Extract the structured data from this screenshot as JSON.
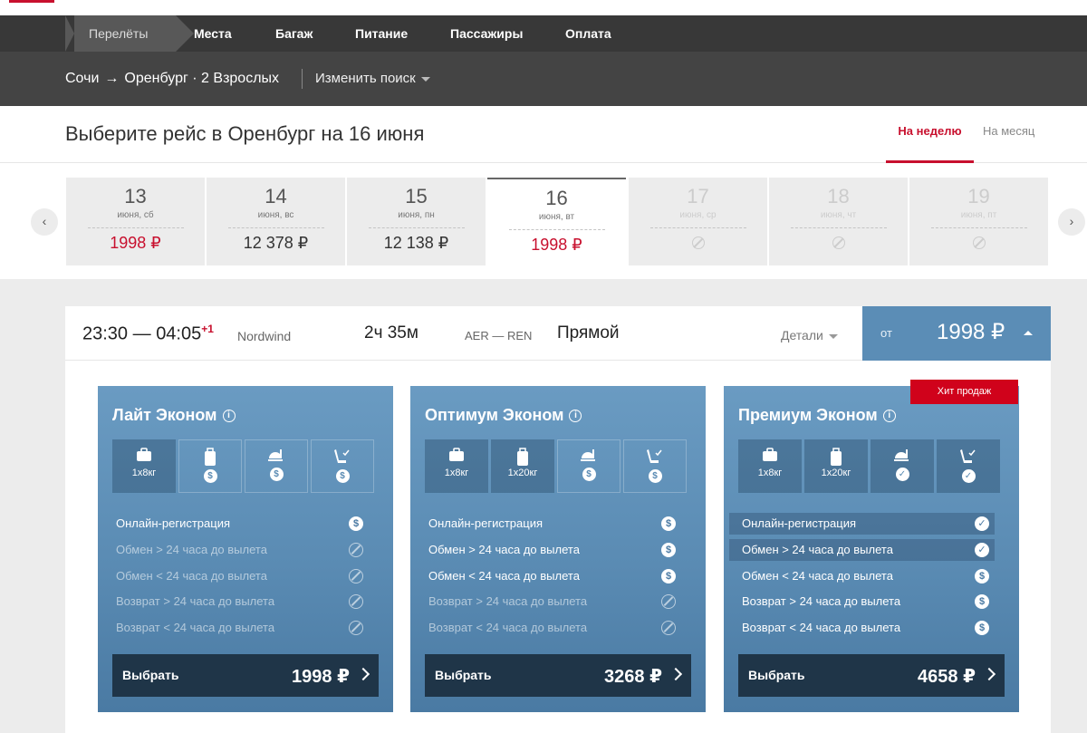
{
  "steps": [
    {
      "label": "Перелёты"
    },
    {
      "label": "Места"
    },
    {
      "label": "Багаж"
    },
    {
      "label": "Питание"
    },
    {
      "label": "Пассажиры"
    },
    {
      "label": "Оплата"
    }
  ],
  "route": {
    "from": "Сочи",
    "arrow": "→",
    "to": "Оренбург",
    "passengers": "· 2 Взрослых",
    "change_label": "Изменить поиск"
  },
  "title": "Выберите рейс в Оренбург на 16 июня",
  "view_tabs": {
    "week": "На неделю",
    "month": "На месяц"
  },
  "nav": {
    "prev": "‹",
    "next": "›"
  },
  "days": [
    {
      "num": "13",
      "weekday": "июня, сб",
      "price": "1998 ₽",
      "lowest": true,
      "available": true
    },
    {
      "num": "14",
      "weekday": "июня, вс",
      "price": "12 378 ₽",
      "lowest": false,
      "available": true
    },
    {
      "num": "15",
      "weekday": "июня, пн",
      "price": "12 138 ₽",
      "lowest": false,
      "available": true
    },
    {
      "num": "16",
      "weekday": "июня, вт",
      "price": "1998 ₽",
      "lowest": true,
      "available": true,
      "selected": true
    },
    {
      "num": "17",
      "weekday": "июня, ср",
      "price": "",
      "available": false
    },
    {
      "num": "18",
      "weekday": "июня, чт",
      "price": "",
      "available": false
    },
    {
      "num": "19",
      "weekday": "июня, пт",
      "price": "",
      "available": false
    }
  ],
  "flight": {
    "dep": "23:30",
    "dash": " — ",
    "arr": "04:05",
    "plus_day": "+1",
    "airline": "Nordwind",
    "duration": "2ч 35м",
    "codes": "AER — REN",
    "type": "Прямой",
    "details_label": "Детали",
    "price_prefix": "от",
    "price": "1998 ₽"
  },
  "fares": [
    {
      "name": "Лайт Эконом",
      "badge": "",
      "features": [
        {
          "icon": "bag-icon",
          "label": "1x8кг",
          "included": true
        },
        {
          "icon": "suitcase-icon",
          "label": "",
          "mark": "$",
          "included": false
        },
        {
          "icon": "meal-icon",
          "label": "",
          "mark": "$",
          "included": false
        },
        {
          "icon": "seat-icon",
          "label": "",
          "mark": "$",
          "included": false
        }
      ],
      "conditions": [
        {
          "text": "Онлайн-регистрация",
          "status": "pay"
        },
        {
          "text": "Обмен > 24 часа до вылета",
          "status": "no"
        },
        {
          "text": "Обмен < 24 часа до вылета",
          "status": "no"
        },
        {
          "text": "Возврат > 24 часа до вылета",
          "status": "no"
        },
        {
          "text": "Возврат < 24 часа до вылета",
          "status": "no"
        }
      ],
      "select_label": "Выбрать",
      "price": "1998 ₽"
    },
    {
      "name": "Оптимум Эконом",
      "badge": "",
      "features": [
        {
          "icon": "bag-icon",
          "label": "1x8кг",
          "included": true
        },
        {
          "icon": "suitcase-icon",
          "label": "1x20кг",
          "included": true
        },
        {
          "icon": "meal-icon",
          "label": "",
          "mark": "$",
          "included": false
        },
        {
          "icon": "seat-icon",
          "label": "",
          "mark": "$",
          "included": false
        }
      ],
      "conditions": [
        {
          "text": "Онлайн-регистрация",
          "status": "pay"
        },
        {
          "text": "Обмен > 24 часа до вылета",
          "status": "pay"
        },
        {
          "text": "Обмен < 24 часа до вылета",
          "status": "pay"
        },
        {
          "text": "Возврат > 24 часа до вылета",
          "status": "no"
        },
        {
          "text": "Возврат < 24 часа до вылета",
          "status": "no"
        }
      ],
      "select_label": "Выбрать",
      "price": "3268 ₽"
    },
    {
      "name": "Премиум Эконом",
      "badge": "Хит продаж",
      "features": [
        {
          "icon": "bag-icon",
          "label": "1x8кг",
          "included": true
        },
        {
          "icon": "suitcase-icon",
          "label": "1x20кг",
          "included": true
        },
        {
          "icon": "meal-icon",
          "label": "",
          "mark": "✓",
          "included": true
        },
        {
          "icon": "seat-icon",
          "label": "",
          "mark": "✓",
          "included": true
        }
      ],
      "conditions": [
        {
          "text": "Онлайн-регистрация",
          "status": "ok"
        },
        {
          "text": "Обмен > 24 часа до вылета",
          "status": "ok"
        },
        {
          "text": "Обмен < 24 часа до вылета",
          "status": "pay"
        },
        {
          "text": "Возврат > 24 часа до вылета",
          "status": "pay"
        },
        {
          "text": "Возврат < 24 часа до вылета",
          "status": "pay"
        }
      ],
      "select_label": "Выбрать",
      "price": "4658 ₽"
    }
  ],
  "colors": {
    "accent_red": "#c8102e",
    "fare_blue": "#5a8bb3",
    "dark_bar": "#383838",
    "select_dark": "#1f3548"
  }
}
